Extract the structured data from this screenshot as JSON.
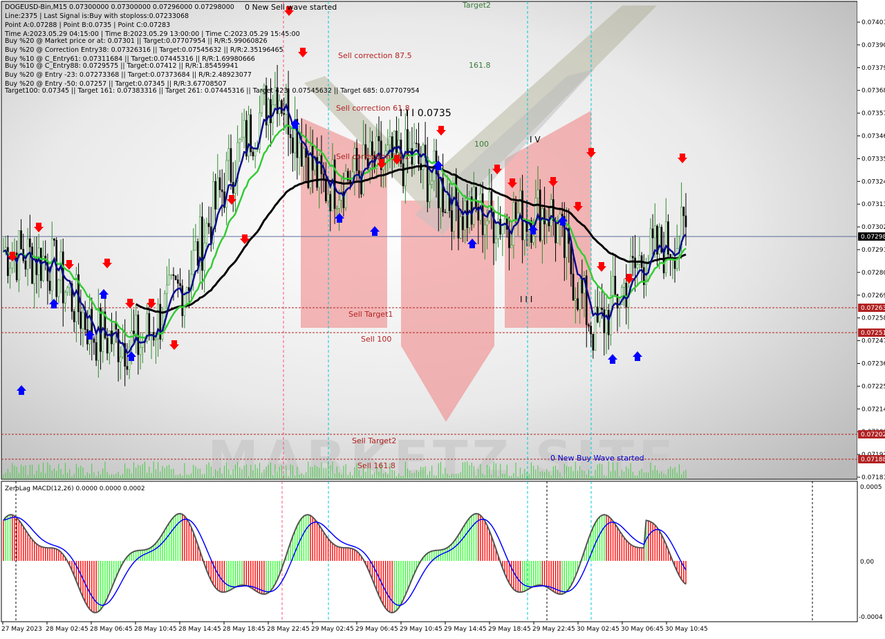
{
  "header": {
    "lines": [
      "DOGEUSD-Bin,M15  0.07300000 0.07300000 0.07296000 0.07298000",
      "Line:2375 | Last Signal is:Buy with stoploss:0.07233068",
      "Point A:0.07288 | Point B:0.0735 | Point C:0.07283",
      "Time A:2023.05.29 04:15:00 | Time B:2023.05.29 13:00:00 | Time C:2023.05.29 15:45:00",
      "Buy %20 @ Market price or at: 0.07301 || Target:0.07707954 || R/R:5.99060826",
      "Buy %20 @ Correction Entry38: 0.07326316 || Target:0.07545632 || R/R:2.35196465",
      "Buy %10 @ C_Entry61: 0.07311684 || Target:0.07445316 || R/R:1.69980666",
      "Buy %10 @ C_Entry88: 0.0729575 || Target:0.07412 || R/R:1.85459941",
      "Buy %20 @ Entry -23: 0.07273368 || Target:0.07373684 || R/R:2.48923077",
      "Buy %20 @ Entry -50: 0.07257 || Target:0.07345 || R/R:3.67708507",
      "Target100: 0.07345 || Target 161: 0.07383316 || Target 261: 0.07445316 || Target 423: 0.07545632 || Target 685: 0.07707954"
    ]
  },
  "annotations": {
    "new_sell_wave": "0 New Sell wave started",
    "new_buy_wave": "0 New Buy Wave started",
    "target2": "Target2",
    "fib_161": "161.8",
    "fib_100": "100",
    "sell_corr_875": "Sell correction 87.5",
    "sell_corr_618": "Sell correction 61.8",
    "sell_corr_382": "Sell correction 38.2",
    "price_level_label": "I I I 0.0735",
    "wave_iv": "I V",
    "wave_iii": "I I I",
    "sell_target1": "Sell Target1",
    "sell_100": "Sell 100",
    "sell_target2": "Sell Target2",
    "sell_1618": "Sell 161.8",
    "watermark": "MARKETZ SITE"
  },
  "price_axis": {
    "labels": [
      "0.07401",
      "0.07390",
      "0.07379",
      "0.07368",
      "0.07357",
      "0.07346",
      "0.07335",
      "0.07324",
      "0.07313",
      "0.07302",
      "0.07291",
      "0.07280",
      "0.07269",
      "0.07258",
      "0.07247",
      "0.07236",
      "0.07225",
      "0.07214",
      "0.07203",
      "0.07192",
      "0.07181"
    ],
    "current": "0.07298",
    "sell_target1": "0.07263",
    "sell_100": "0.07251",
    "sell_target2": "0.07202",
    "sell_1618": "0.07188"
  },
  "macd": {
    "title": "ZeroLag MACD(12,26) 0.0000 0.0000 0.0002",
    "axis": [
      "0.0005",
      "0.00",
      "-0.0004"
    ]
  },
  "time_axis": [
    "27 May 2023",
    "28 May 02:45",
    "28 May 06:45",
    "28 May 10:45",
    "28 May 14:45",
    "28 May 18:45",
    "28 May 22:45",
    "29 May 02:45",
    "29 May 06:45",
    "29 May 10:45",
    "29 May 14:45",
    "29 May 18:45",
    "29 May 22:45",
    "30 May 02:45",
    "30 May 06:45",
    "30 May 10:45"
  ],
  "colors": {
    "background": "#ffffff",
    "bull_candle": "#2e8b2e",
    "bear_candle": "#000000",
    "ma_fast": "#0a0a8c",
    "ma_mid": "#33cc33",
    "ma_slow": "#000000",
    "sell_level": "#b22222",
    "sell_arrow": "#ff0000",
    "buy_arrow": "#0000ff",
    "macd_pos": "#33ff33",
    "macd_neg": "#ff0000",
    "macd_signal": "#0000ff",
    "cyan_vline": "#00c8d8",
    "pink_vline": "#ff5078",
    "price_badge": "#b22222"
  },
  "chart_data": [
    {
      "type": "candlestick",
      "symbol": "DOGEUSD-Bin",
      "timeframe": "M15",
      "ylim": [
        0.0718,
        0.0741
      ],
      "close_path": [
        {
          "t": "27 May 2023",
          "c": 0.0729
        },
        {
          "t": "28 May 02:45",
          "c": 0.07285
        },
        {
          "t": "28 May 06:45",
          "c": 0.0725
        },
        {
          "t": "28 May 10:45",
          "c": 0.07245
        },
        {
          "t": "28 May 14:45",
          "c": 0.07275
        },
        {
          "t": "28 May 18:45",
          "c": 0.0733
        },
        {
          "t": "28 May 22:45",
          "c": 0.0737
        },
        {
          "t": "29 May 02:45",
          "c": 0.0732
        },
        {
          "t": "29 May 06:45",
          "c": 0.0733
        },
        {
          "t": "29 May 10:45",
          "c": 0.07335
        },
        {
          "t": "29 May 14:45",
          "c": 0.0731
        },
        {
          "t": "29 May 18:45",
          "c": 0.07305
        },
        {
          "t": "29 May 22:45",
          "c": 0.0731
        },
        {
          "t": "30 May 02:45",
          "c": 0.0725
        },
        {
          "t": "30 May 06:45",
          "c": 0.07285
        },
        {
          "t": "30 May 10:45",
          "c": 0.07298
        }
      ],
      "horizontal_levels": [
        {
          "name": "Sell Target1",
          "value": 0.07263
        },
        {
          "name": "Sell 100",
          "value": 0.07251
        },
        {
          "name": "Sell Target2",
          "value": 0.07202
        },
        {
          "name": "Sell 161.8",
          "value": 0.07188
        },
        {
          "name": "Current",
          "value": 0.07298
        }
      ]
    },
    {
      "type": "bar",
      "name": "ZeroLag MACD(12,26)",
      "ylim": [
        -0.0004,
        0.0005
      ]
    }
  ]
}
